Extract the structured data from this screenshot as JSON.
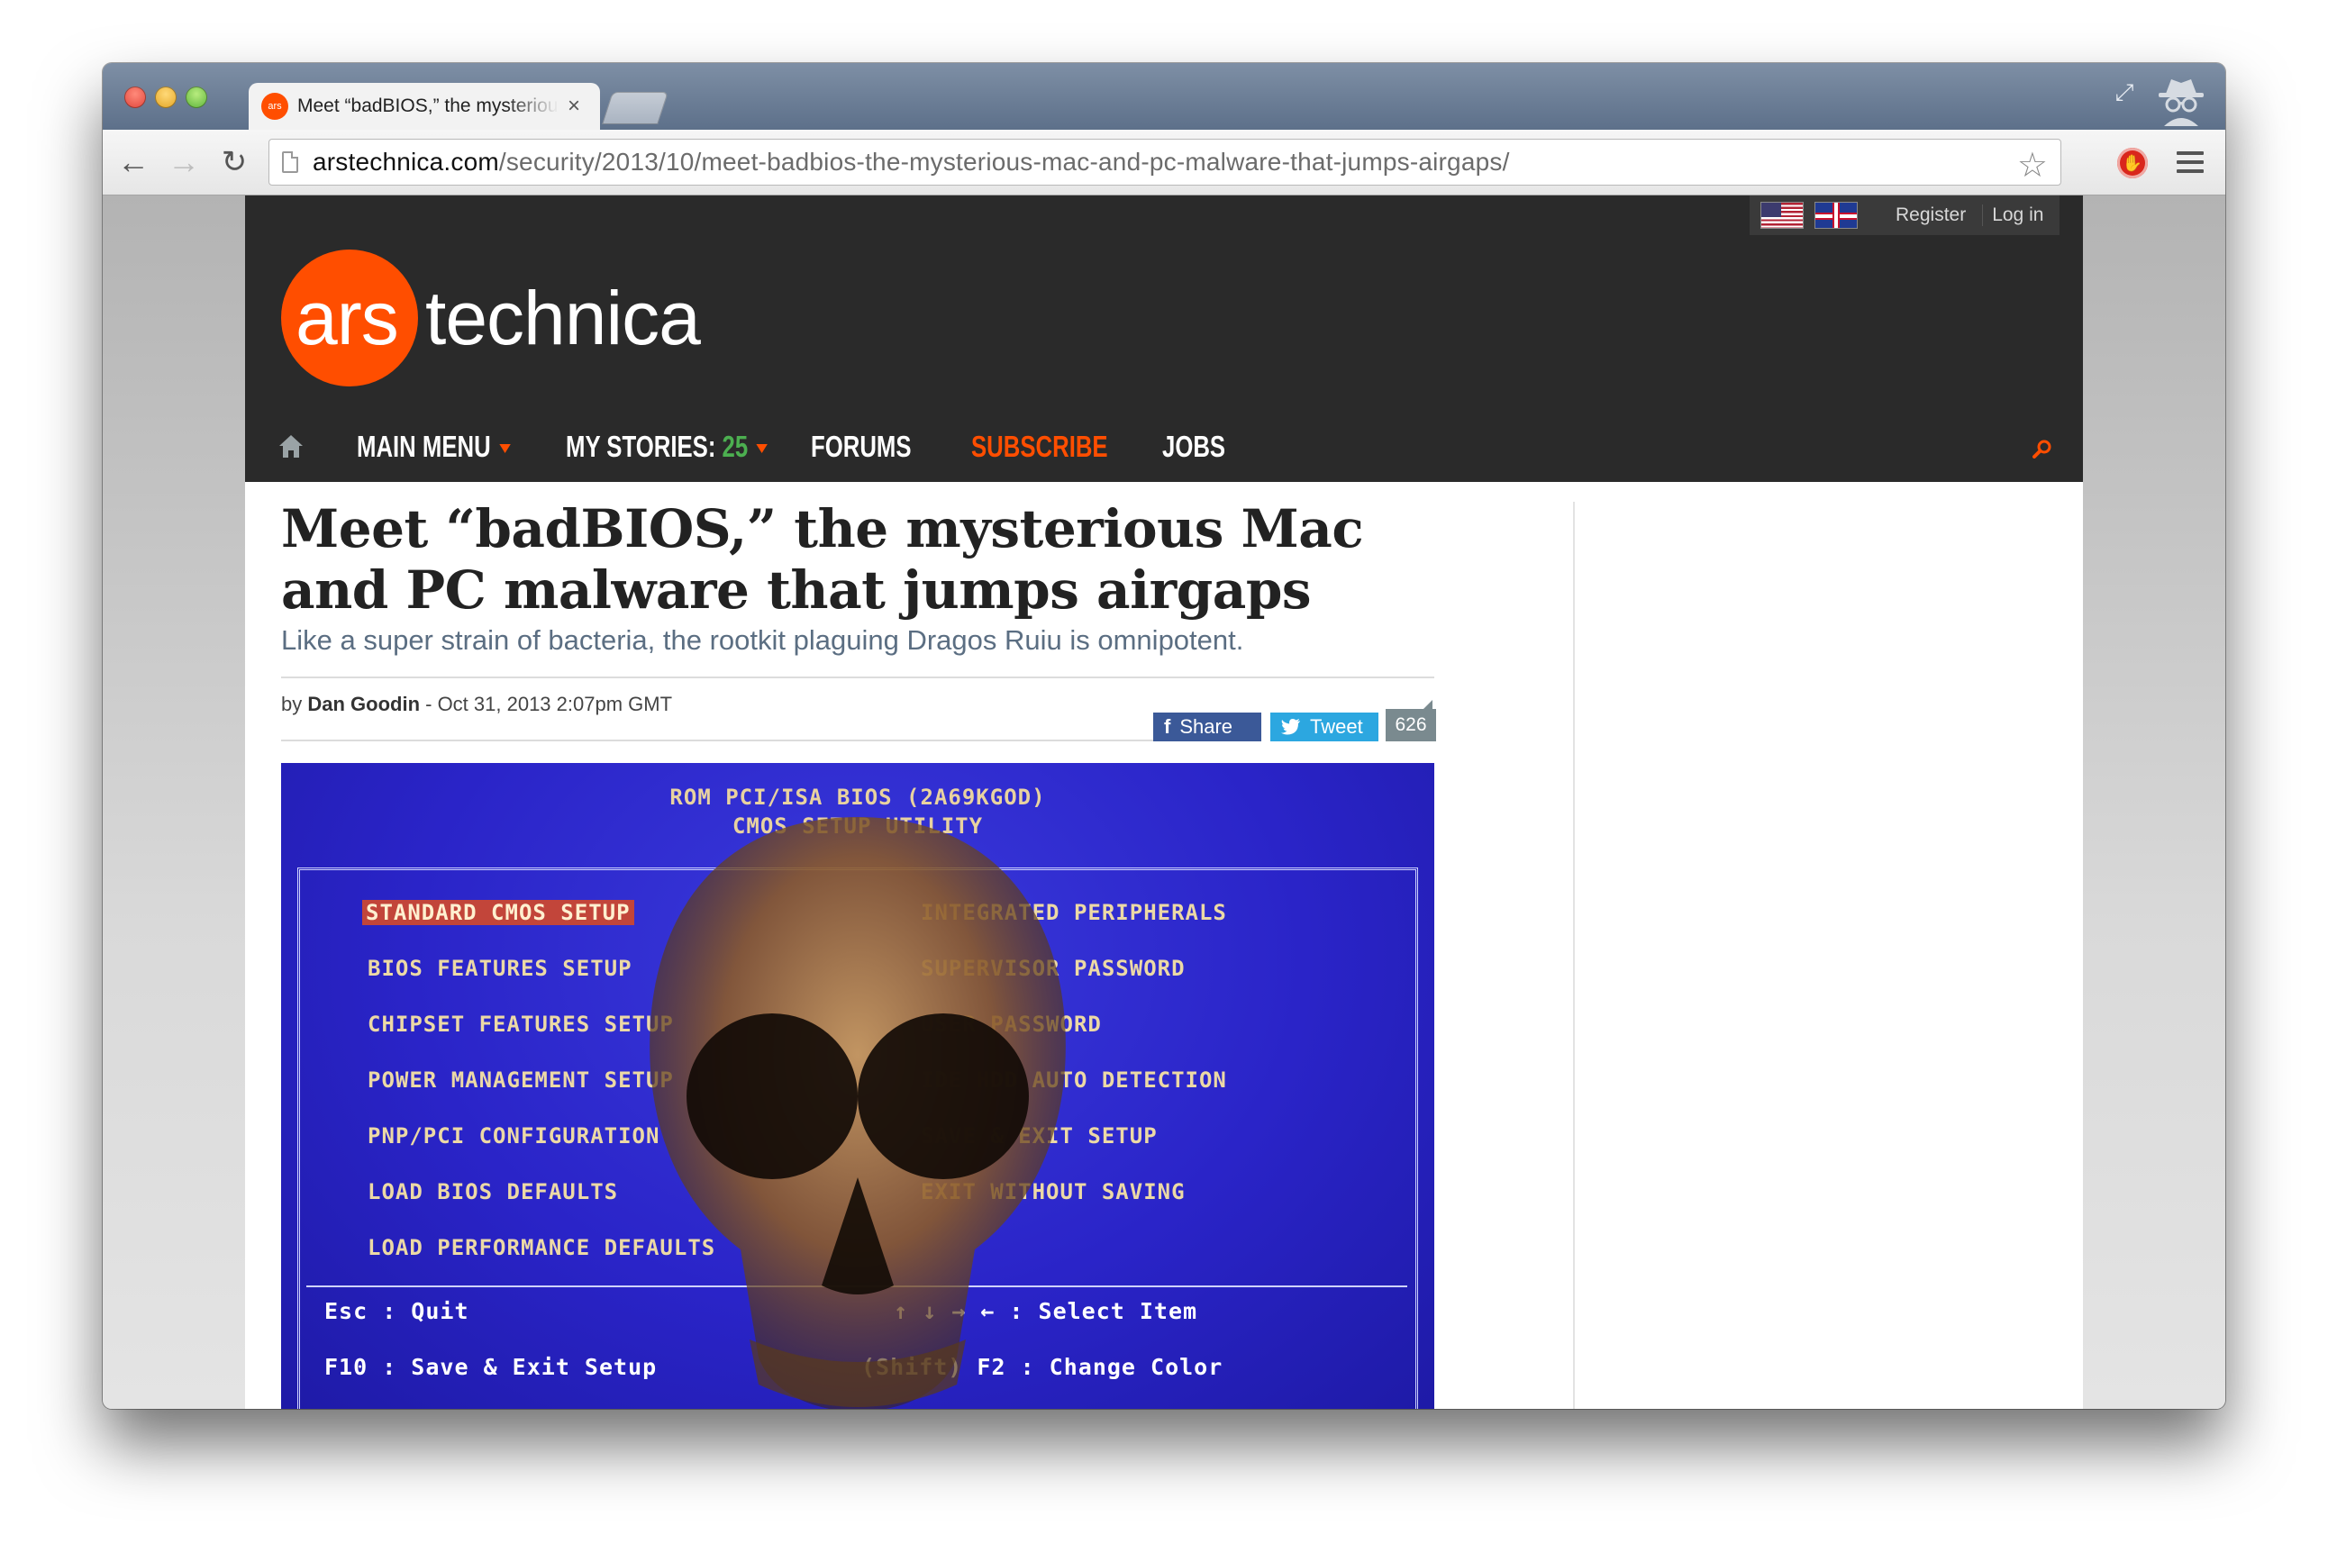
{
  "browser": {
    "tab": {
      "favicon_text": "ars",
      "title": "Meet “badBIOS,” the mysterious Mac and PC malware that jumps airgaps",
      "close_glyph": "×"
    },
    "url": {
      "host": "arstechnica.com",
      "path": "/security/2013/10/meet-badbios-the-mysterious-mac-and-pc-malware-that-jumps-airgaps/"
    },
    "icons": {
      "back": "back-arrow-icon",
      "forward": "forward-arrow-icon",
      "reload": "reload-icon",
      "bookmark": "star-icon",
      "extension": "adblock-icon",
      "menu": "hamburger-menu-icon",
      "fullscreen": "fullscreen-icon",
      "incognito": "incognito-icon"
    },
    "glyphs": {
      "back": "←",
      "forward": "→",
      "reload": "↻",
      "star": "☆",
      "fullscreen": "⤢",
      "extension": "✋"
    }
  },
  "site": {
    "brand_color": "#ff4e00",
    "locale": {
      "register": "Register",
      "login": "Log in"
    },
    "logo": {
      "ars": "ars",
      "technica": "technica"
    },
    "nav": {
      "main_menu": "MAIN MENU",
      "my_stories": "MY STORIES:",
      "my_stories_count": "25",
      "forums": "FORUMS",
      "subscribe": "SUBSCRIBE",
      "jobs": "JOBS"
    }
  },
  "article": {
    "headline": "Meet “badBIOS,” the mysterious Mac and PC malware that jumps airgaps",
    "dek": "Like a super strain of bacteria, the rootkit plaguing Dragos Ruiu is omnipotent.",
    "byline_prefix": "by ",
    "author": "Dan Goodin",
    "dateline": " - Oct 31, 2013 2:07pm GMT",
    "share": {
      "facebook_label": "Share",
      "twitter_label": "Tweet",
      "comment_count": "626"
    },
    "hero": {
      "title_line1": "ROM PCI/ISA BIOS (2A69KGOD)",
      "title_line2": "CMOS SETUP UTILITY",
      "left_items": [
        "STANDARD CMOS SETUP",
        "BIOS FEATURES SETUP",
        "CHIPSET FEATURES SETUP",
        "POWER MANAGEMENT SETUP",
        "PNP/PCI CONFIGURATION",
        "LOAD BIOS DEFAULTS",
        "LOAD PERFORMANCE DEFAULTS"
      ],
      "right_items": [
        "INTEGRATED PERIPHERALS",
        "SUPERVISOR PASSWORD",
        "USER PASSWORD",
        "IDE HDD AUTO DETECTION",
        "SAVE & EXIT SETUP",
        "EXIT WITHOUT SAVING"
      ],
      "keys": {
        "esc": "Esc : Quit",
        "f10": "F10 : Save & Exit Setup",
        "select": "↑ ↓ → ← : Select Item",
        "color": "(Shift) F2 : Change Color"
      }
    }
  }
}
